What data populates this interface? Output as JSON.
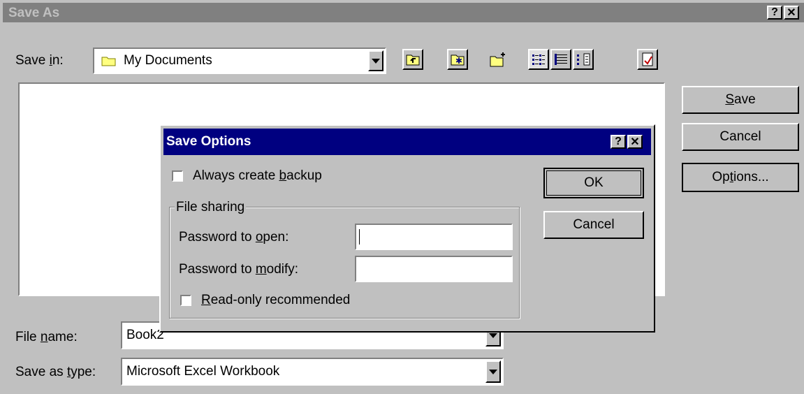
{
  "save_as": {
    "title": "Save As",
    "save_in": {
      "label_pre": "Save ",
      "label_key": "i",
      "label_post": "n:",
      "value": "My Documents"
    },
    "file_name": {
      "label_pre": "File ",
      "label_key": "n",
      "label_post": "ame:",
      "value": "Book2"
    },
    "save_type": {
      "label_pre": "Save as ",
      "label_key": "t",
      "label_post": "ype:",
      "value": "Microsoft Excel Workbook"
    },
    "buttons": {
      "save": {
        "key": "S",
        "rest": "ave"
      },
      "cancel": "Cancel",
      "options": {
        "pre": "Op",
        "key": "t",
        "post": "ions..."
      }
    },
    "toolbar_icons": [
      "up-one-level-icon",
      "favorites-icon",
      "create-new-folder-icon",
      "list-view-icon",
      "details-view-icon",
      "properties-view-icon",
      "commands-icon"
    ]
  },
  "save_options": {
    "title": "Save Options",
    "backup": {
      "pre": "Always create ",
      "key": "b",
      "post": "ackup",
      "checked": false
    },
    "file_sharing_label": "File sharing",
    "password_open": {
      "pre": "Password to ",
      "key": "o",
      "post": "pen:",
      "value": ""
    },
    "password_modify": {
      "pre": "Password to ",
      "key": "m",
      "post": "odify:",
      "value": ""
    },
    "readonly": {
      "key": "R",
      "post": "ead-only recommended",
      "checked": false
    },
    "ok": "OK",
    "cancel": "Cancel"
  },
  "colors": {
    "dialog_face": "#c0c0c0",
    "inactive_title": "#808080",
    "active_title": "#000080"
  }
}
